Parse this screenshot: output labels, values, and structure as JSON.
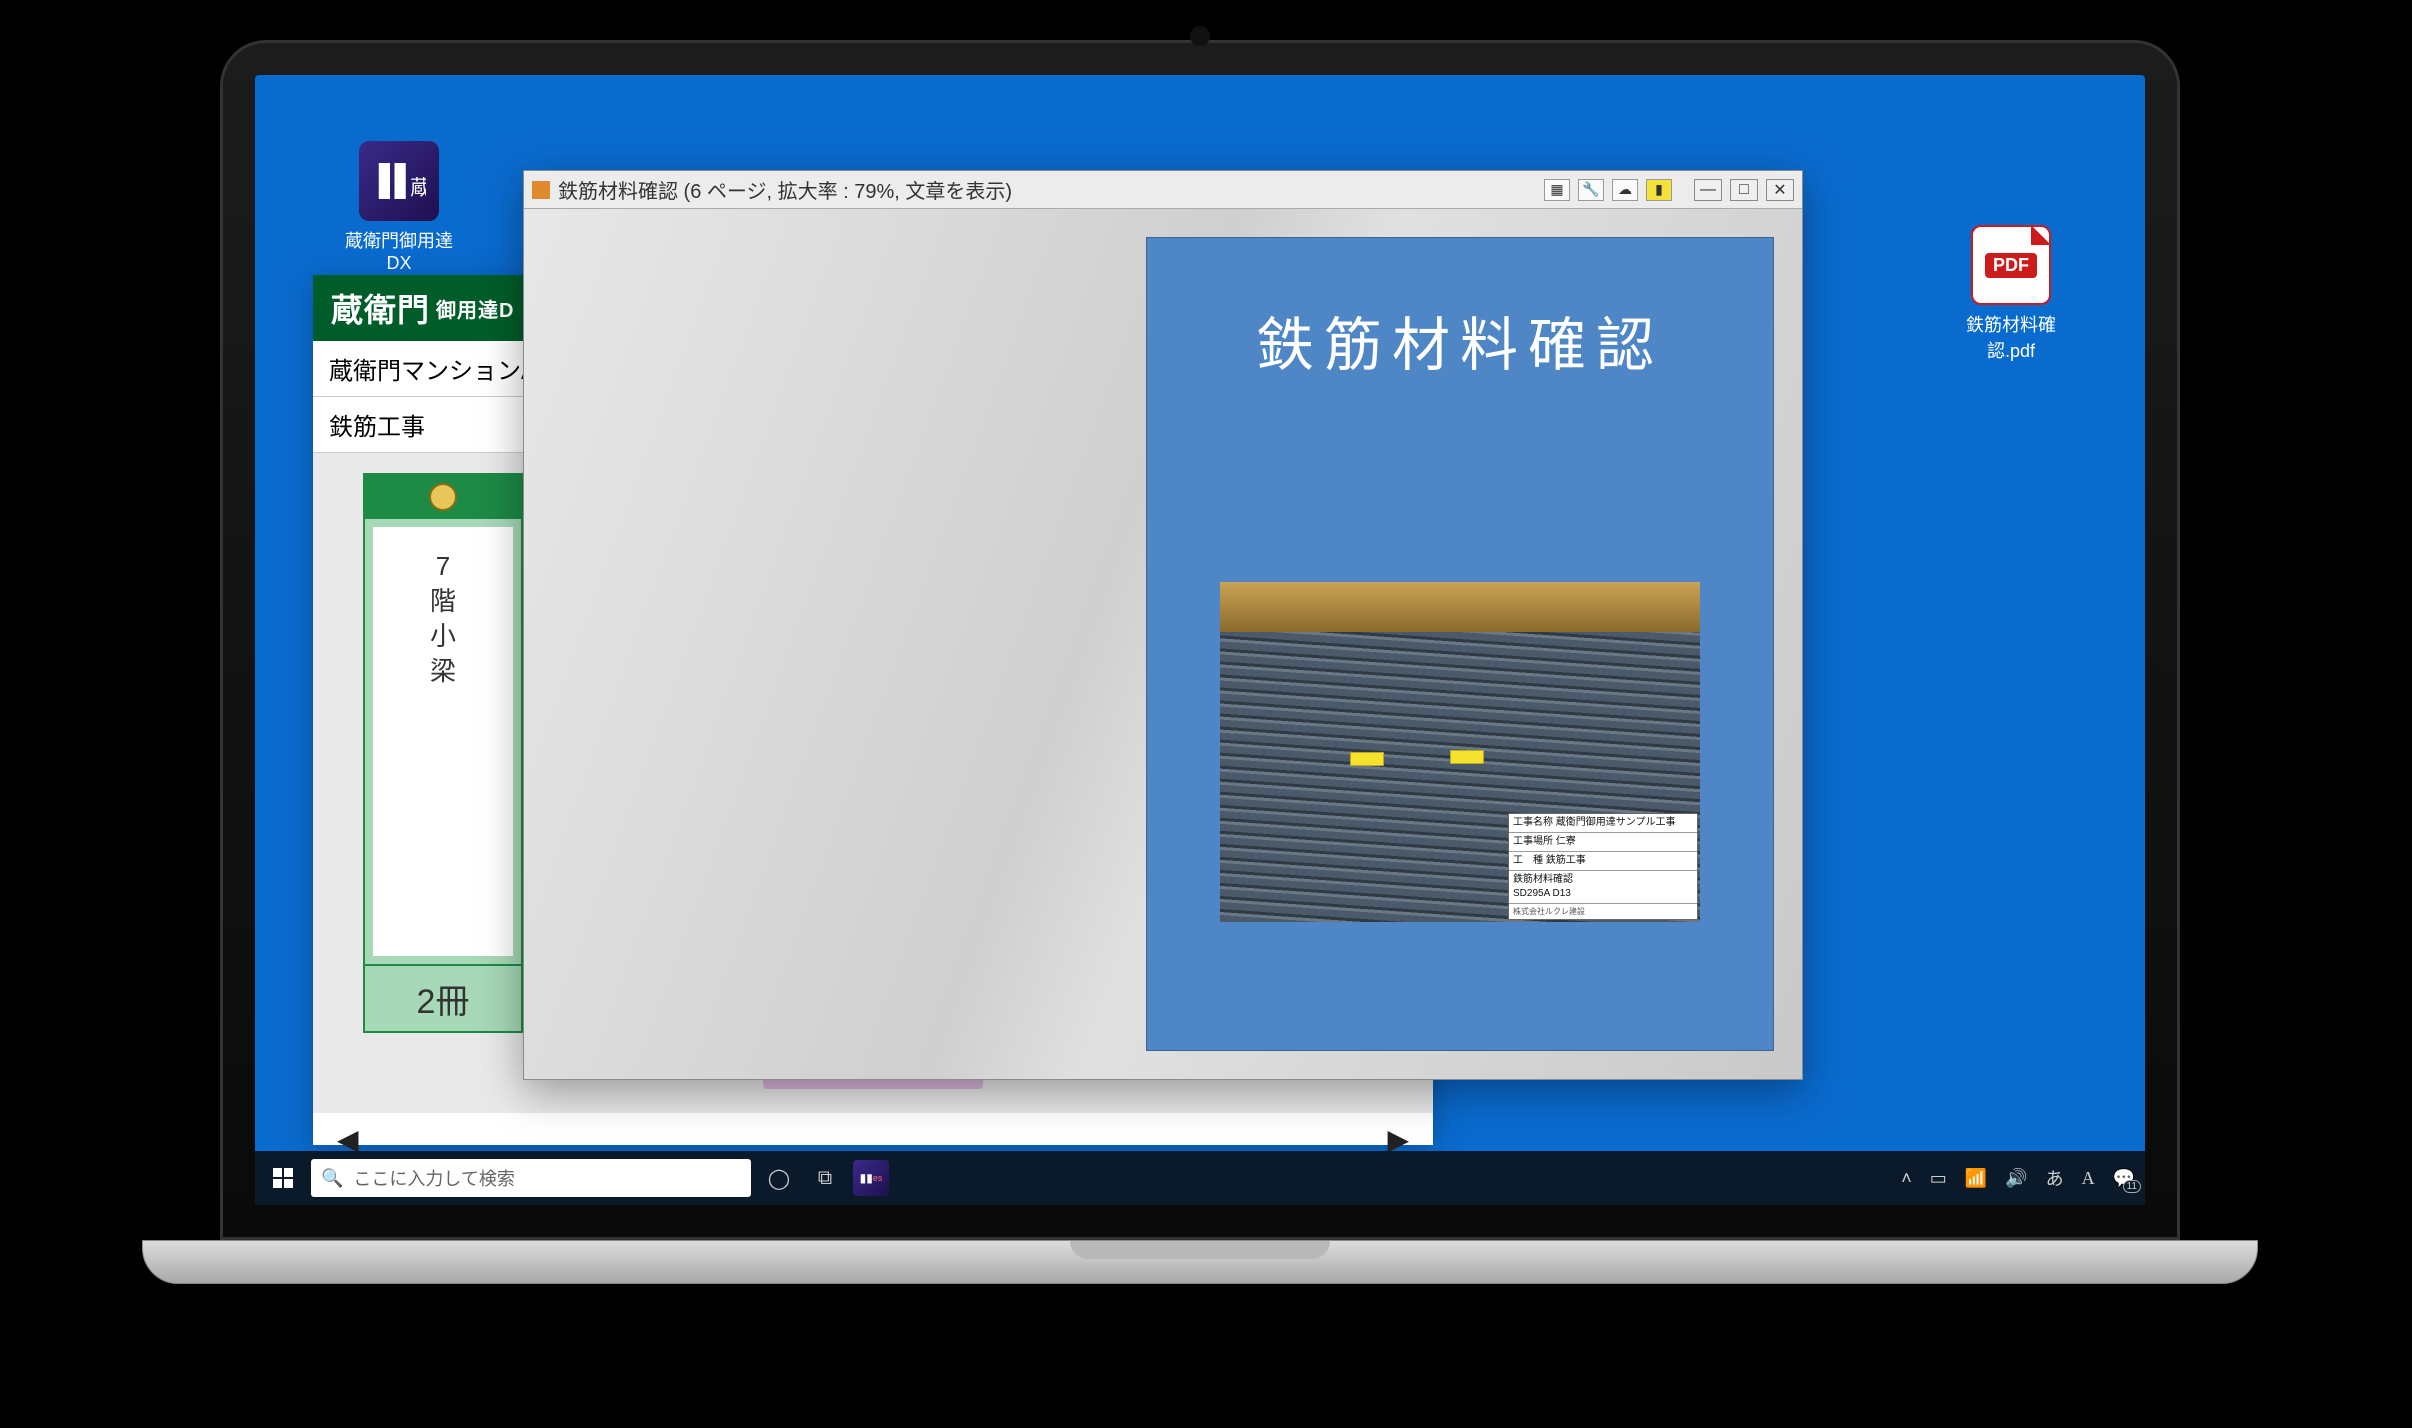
{
  "desktop": {
    "app_icon_label": "蔵衛門御用達 DX",
    "pdf_icon_label": "鉄筋材料確認.pdf",
    "pdf_badge": "PDF"
  },
  "bg_app": {
    "brand": "蔵衛門",
    "brand_sub": "御用達D",
    "project_row": "蔵衛門マンションA",
    "category_row": "鉄筋工事",
    "book_label_lines": [
      "7",
      "階",
      "小",
      "梁"
    ],
    "book_count": "2冊",
    "nav_left": "◀",
    "nav_right": "▶"
  },
  "viewer": {
    "title_text": "鉄筋材料確認 (6 ページ, 拡大率 : 79%, 文章を表示)",
    "toolbar_icons": [
      "grid-icon",
      "key-icon",
      "cloud-icon",
      "pin-icon"
    ],
    "window_controls": [
      "minimize",
      "maximize",
      "close"
    ],
    "doc_title": "鉄筋材料確認",
    "label": {
      "r1": "工事名称  蔵衛門御用達サンプル工事",
      "r2": "工事場所  仁寮",
      "r3": "工　種   鉄筋工事",
      "r4": "鉄筋材料確認\nSD295A  D13",
      "footer_left": "株式会社ルクレ建設",
      "footer_right": ""
    }
  },
  "taskbar": {
    "search_placeholder": "ここに入力して検索",
    "tray_badge_count": "11"
  }
}
